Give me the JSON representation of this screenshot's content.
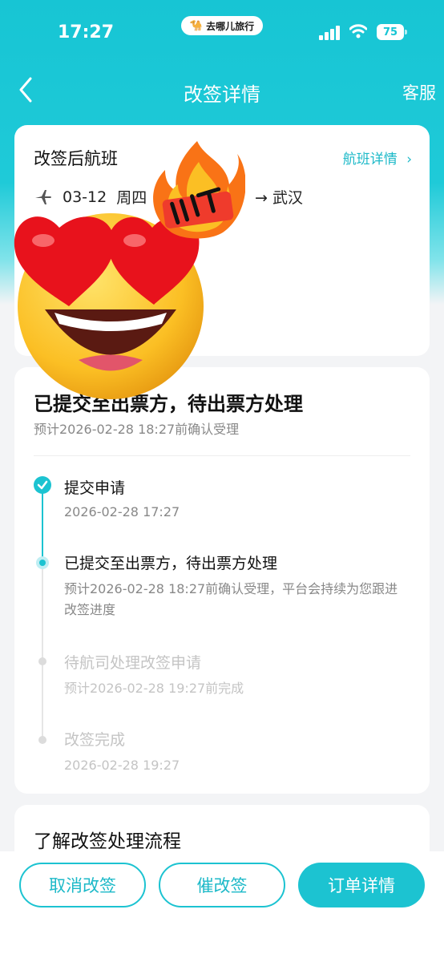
{
  "status_bar": {
    "time": "17:27",
    "app_pill": "去哪儿旅行",
    "battery": "75",
    "icons": [
      "signal-icon",
      "wifi-icon",
      "battery-icon"
    ]
  },
  "nav": {
    "title": "改签详情",
    "service": "客服"
  },
  "flight_card": {
    "title": "改签后航班",
    "link": "航班详情",
    "date": "03-12",
    "weekday": "周四",
    "arrival_city": "武汉"
  },
  "status_card": {
    "title": "已提交至出票方，待出票方处理",
    "subtitle": "预计2026-02-28 18:27前确认受理",
    "steps": [
      {
        "title": "提交申请",
        "sub": "2026-02-28 17:27",
        "state": "done"
      },
      {
        "title": "已提交至出票方，待出票方处理",
        "sub": "预计2026-02-28 18:27前确认受理，平台会持续为您跟进改签进度",
        "state": "current"
      },
      {
        "title": "待航司处理改签申请",
        "sub": "预计2026-02-28 19:27前完成",
        "state": "pending"
      },
      {
        "title": "改签完成",
        "sub": "2026-02-28 19:27",
        "state": "pending"
      }
    ]
  },
  "process_card": {
    "title": "了解改签处理流程"
  },
  "bottom_bar": {
    "cancel": "取消改签",
    "urge": "催改签",
    "order": "订单详情"
  },
  "colors": {
    "brand": "#1cc3d1",
    "text_dark": "#111111",
    "text_gray": "#888888",
    "text_faint": "#c4c4c4"
  },
  "overlay": {
    "stickers": [
      "heart-eyes-emoji",
      "fire-lit-sticker"
    ]
  }
}
